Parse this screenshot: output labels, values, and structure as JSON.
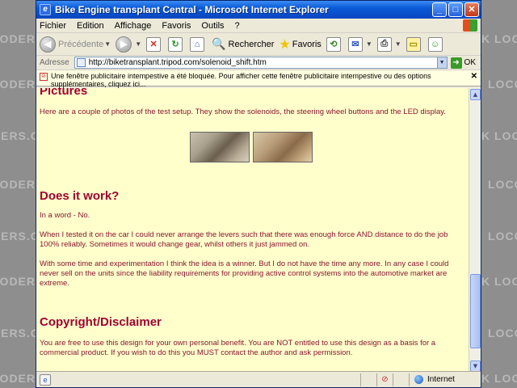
{
  "window": {
    "title": "Bike Engine transplant Central - Microsoft Internet Explorer"
  },
  "menu": {
    "items": [
      "Fichier",
      "Edition",
      "Affichage",
      "Favoris",
      "Outils",
      "?"
    ]
  },
  "toolbar": {
    "back_label": "Précédente",
    "search_label": "Rechercher",
    "favorites_label": "Favoris"
  },
  "address": {
    "label": "Adresse",
    "url": "http://biketransplant.tripod.com/solenoid_shift.htm",
    "go_label": "OK"
  },
  "infobar": {
    "text": "Une fenêtre publicitaire intempestive a été bloquée. Pour afficher cette fenêtre publicitaire intempestive ou des options supplémentaires, cliquez ici..."
  },
  "content": {
    "pictures_heading": "Pictures",
    "pictures_text": "Here are a couple of photos of the test setup. They show the solenoids, the steering wheel buttons and the LED display.",
    "works_heading": "Does it work?",
    "works_p1": "In a word - No.",
    "works_p2": "When I tested it on the car I could never arrange the levers such that there was enough force AND distance to do the job 100% reliably. Sometimes it would change gear, whilst others it just jammed on.",
    "works_p3": "With some time and experimentation I think the idea is a winner. But I do not have the time any more. In any case I could never sell on the units since the liability requirements for providing active control systems into the automotive market are extreme.",
    "copyright_heading": "Copyright/Disclaimer",
    "copyright_text": "You are free to use this design for your own personal benefit. You are NOT entitled to use this design as a basis for a commercial product. If you wish to do this you MUST contact the author and ask permission."
  },
  "status": {
    "zone": "Internet"
  },
  "background": {
    "left_fragments": [
      "LODERS.CO.UK",
      "LODERS.CO.UK",
      "DERS.CO.UK",
      "LODERS.CO.UK",
      "DERS.CO.UK",
      "LODERS.CO.UK",
      "DERS.CO.UK",
      "LODERS.CO.UK"
    ],
    "right_fragments": [
      "K LOCOST",
      "LOCOST",
      "K LOCOST",
      "LOCOST",
      "LOCOST",
      "K LOCOST",
      "LOCOST",
      "K LOCOST"
    ]
  },
  "colors": {
    "page_bg": "#ffffcc",
    "heading": "#a0002f",
    "text": "#8a1530"
  }
}
